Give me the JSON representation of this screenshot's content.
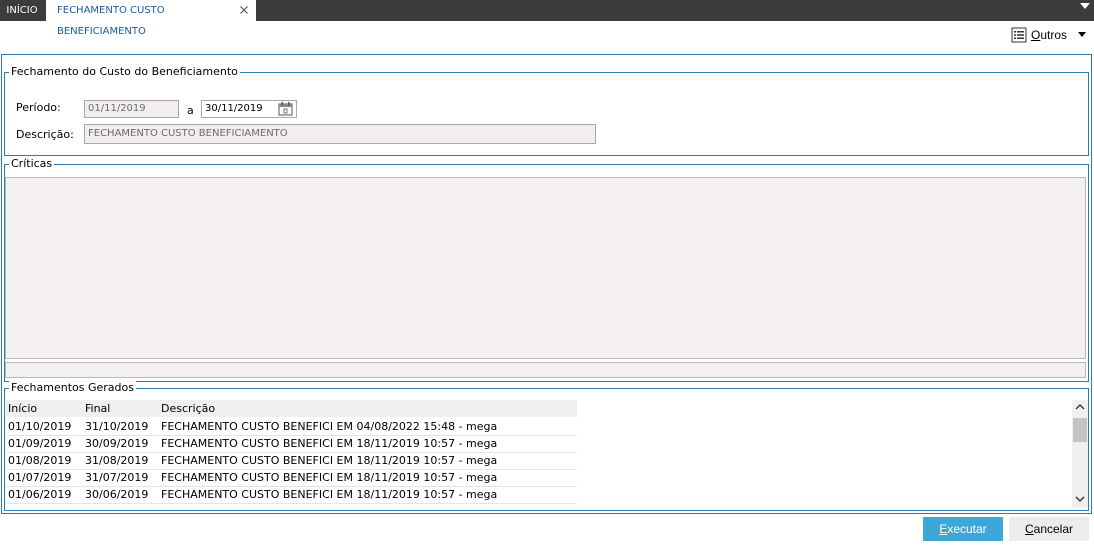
{
  "tabs": {
    "home": "INÍCIO",
    "active": "FECHAMENTO CUSTO BENEFICIAMENTO"
  },
  "toolbar": {
    "outros_first": "O",
    "outros_rest": "utros"
  },
  "group_fechamento": {
    "legend": "Fechamento do Custo do Beneficiamento",
    "periodo_label": "Período:",
    "periodo_inicio": "01/11/2019",
    "periodo_sep": "a",
    "periodo_fim": "30/11/2019",
    "descricao_label": "Descrição:",
    "descricao_value": "FECHAMENTO CUSTO BENEFICIAMENTO"
  },
  "group_criticas": {
    "legend": "Críticas"
  },
  "group_fechamentos": {
    "legend": "Fechamentos Gerados",
    "columns": [
      "Início",
      "Final",
      "Descrição"
    ],
    "rows": [
      [
        "01/10/2019",
        "31/10/2019",
        "FECHAMENTO CUSTO BENEFICI EM 04/08/2022 15:48 - mega"
      ],
      [
        "01/09/2019",
        "30/09/2019",
        "FECHAMENTO CUSTO BENEFICI EM 18/11/2019 10:57 - mega"
      ],
      [
        "01/08/2019",
        "31/08/2019",
        "FECHAMENTO CUSTO BENEFICI EM 18/11/2019 10:57 - mega"
      ],
      [
        "01/07/2019",
        "31/07/2019",
        "FECHAMENTO CUSTO BENEFICI EM 18/11/2019 10:57 - mega"
      ],
      [
        "01/06/2019",
        "30/06/2019",
        "FECHAMENTO CUSTO BENEFICI EM 18/11/2019 10:57 - mega"
      ]
    ]
  },
  "buttons": {
    "executar_first": "E",
    "executar_rest": "xecutar",
    "cancelar_first": "C",
    "cancelar_rest": "ancelar"
  },
  "colors": {
    "tabbar_bg": "#3c3c3c",
    "accent": "#2e7ab3",
    "primary_button": "#3ea7d8",
    "readonly_field_bg": "#f2eef0"
  }
}
